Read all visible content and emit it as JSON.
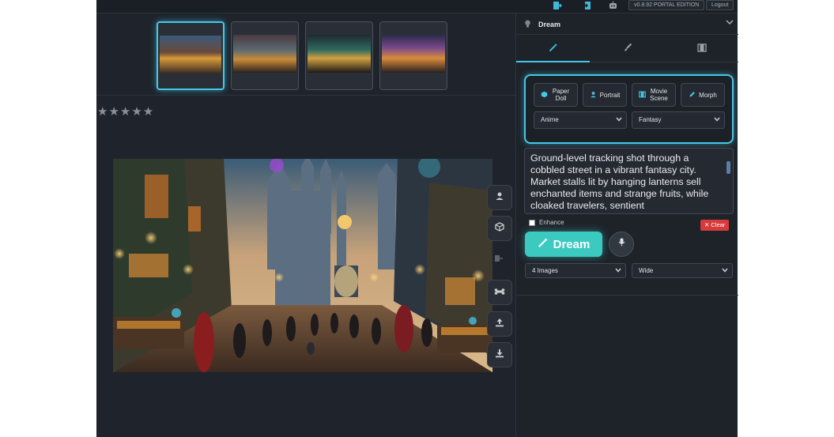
{
  "topbar": {
    "icons": [
      "export-icon",
      "import-icon",
      "robot-icon"
    ],
    "version": "v0.8.92 PORTAL EDITION",
    "logout_label": "Logout"
  },
  "thumbnails": [
    {
      "name": "thumb-1",
      "active": true
    },
    {
      "name": "thumb-2",
      "active": false
    },
    {
      "name": "thumb-3",
      "active": false
    },
    {
      "name": "thumb-4",
      "active": false
    }
  ],
  "rating": {
    "stars": "★★★★★",
    "value": 0,
    "max": 5
  },
  "side_tools": [
    "person-icon",
    "cube-icon",
    "arrow-icon",
    "bone-icon",
    "upload-icon",
    "download-icon"
  ],
  "panel": {
    "title": "Dream",
    "tabs": [
      {
        "icon": "magic-wand-icon",
        "active": true
      },
      {
        "icon": "brush-icon",
        "active": false
      },
      {
        "icon": "film-icon",
        "active": false
      }
    ],
    "presets": [
      {
        "label": "Paper Doll",
        "icon": "cube-icon"
      },
      {
        "label": "Portrait",
        "icon": "person-icon"
      },
      {
        "label": "Movie Scene",
        "icon": "film-icon"
      },
      {
        "label": "Morph",
        "icon": "pencil-icon"
      }
    ],
    "style_select": "Anime",
    "genre_select": "Fantasy",
    "prompt": "Ground-level tracking shot through a cobbled street in a vibrant fantasy city. Market stalls lit by hanging lanterns sell enchanted items and strange fruits, while cloaked travelers, sentient",
    "enhance_label": "Enhance",
    "clear_label": "✕ Clear",
    "dream_label": "Dream",
    "count_select": "4 Images",
    "aspect_select": "Wide"
  },
  "colors": {
    "accent": "#45c8e8",
    "dream_button": "#3cc9c0",
    "clear_button": "#d63a3a",
    "background": "#1f242c"
  }
}
